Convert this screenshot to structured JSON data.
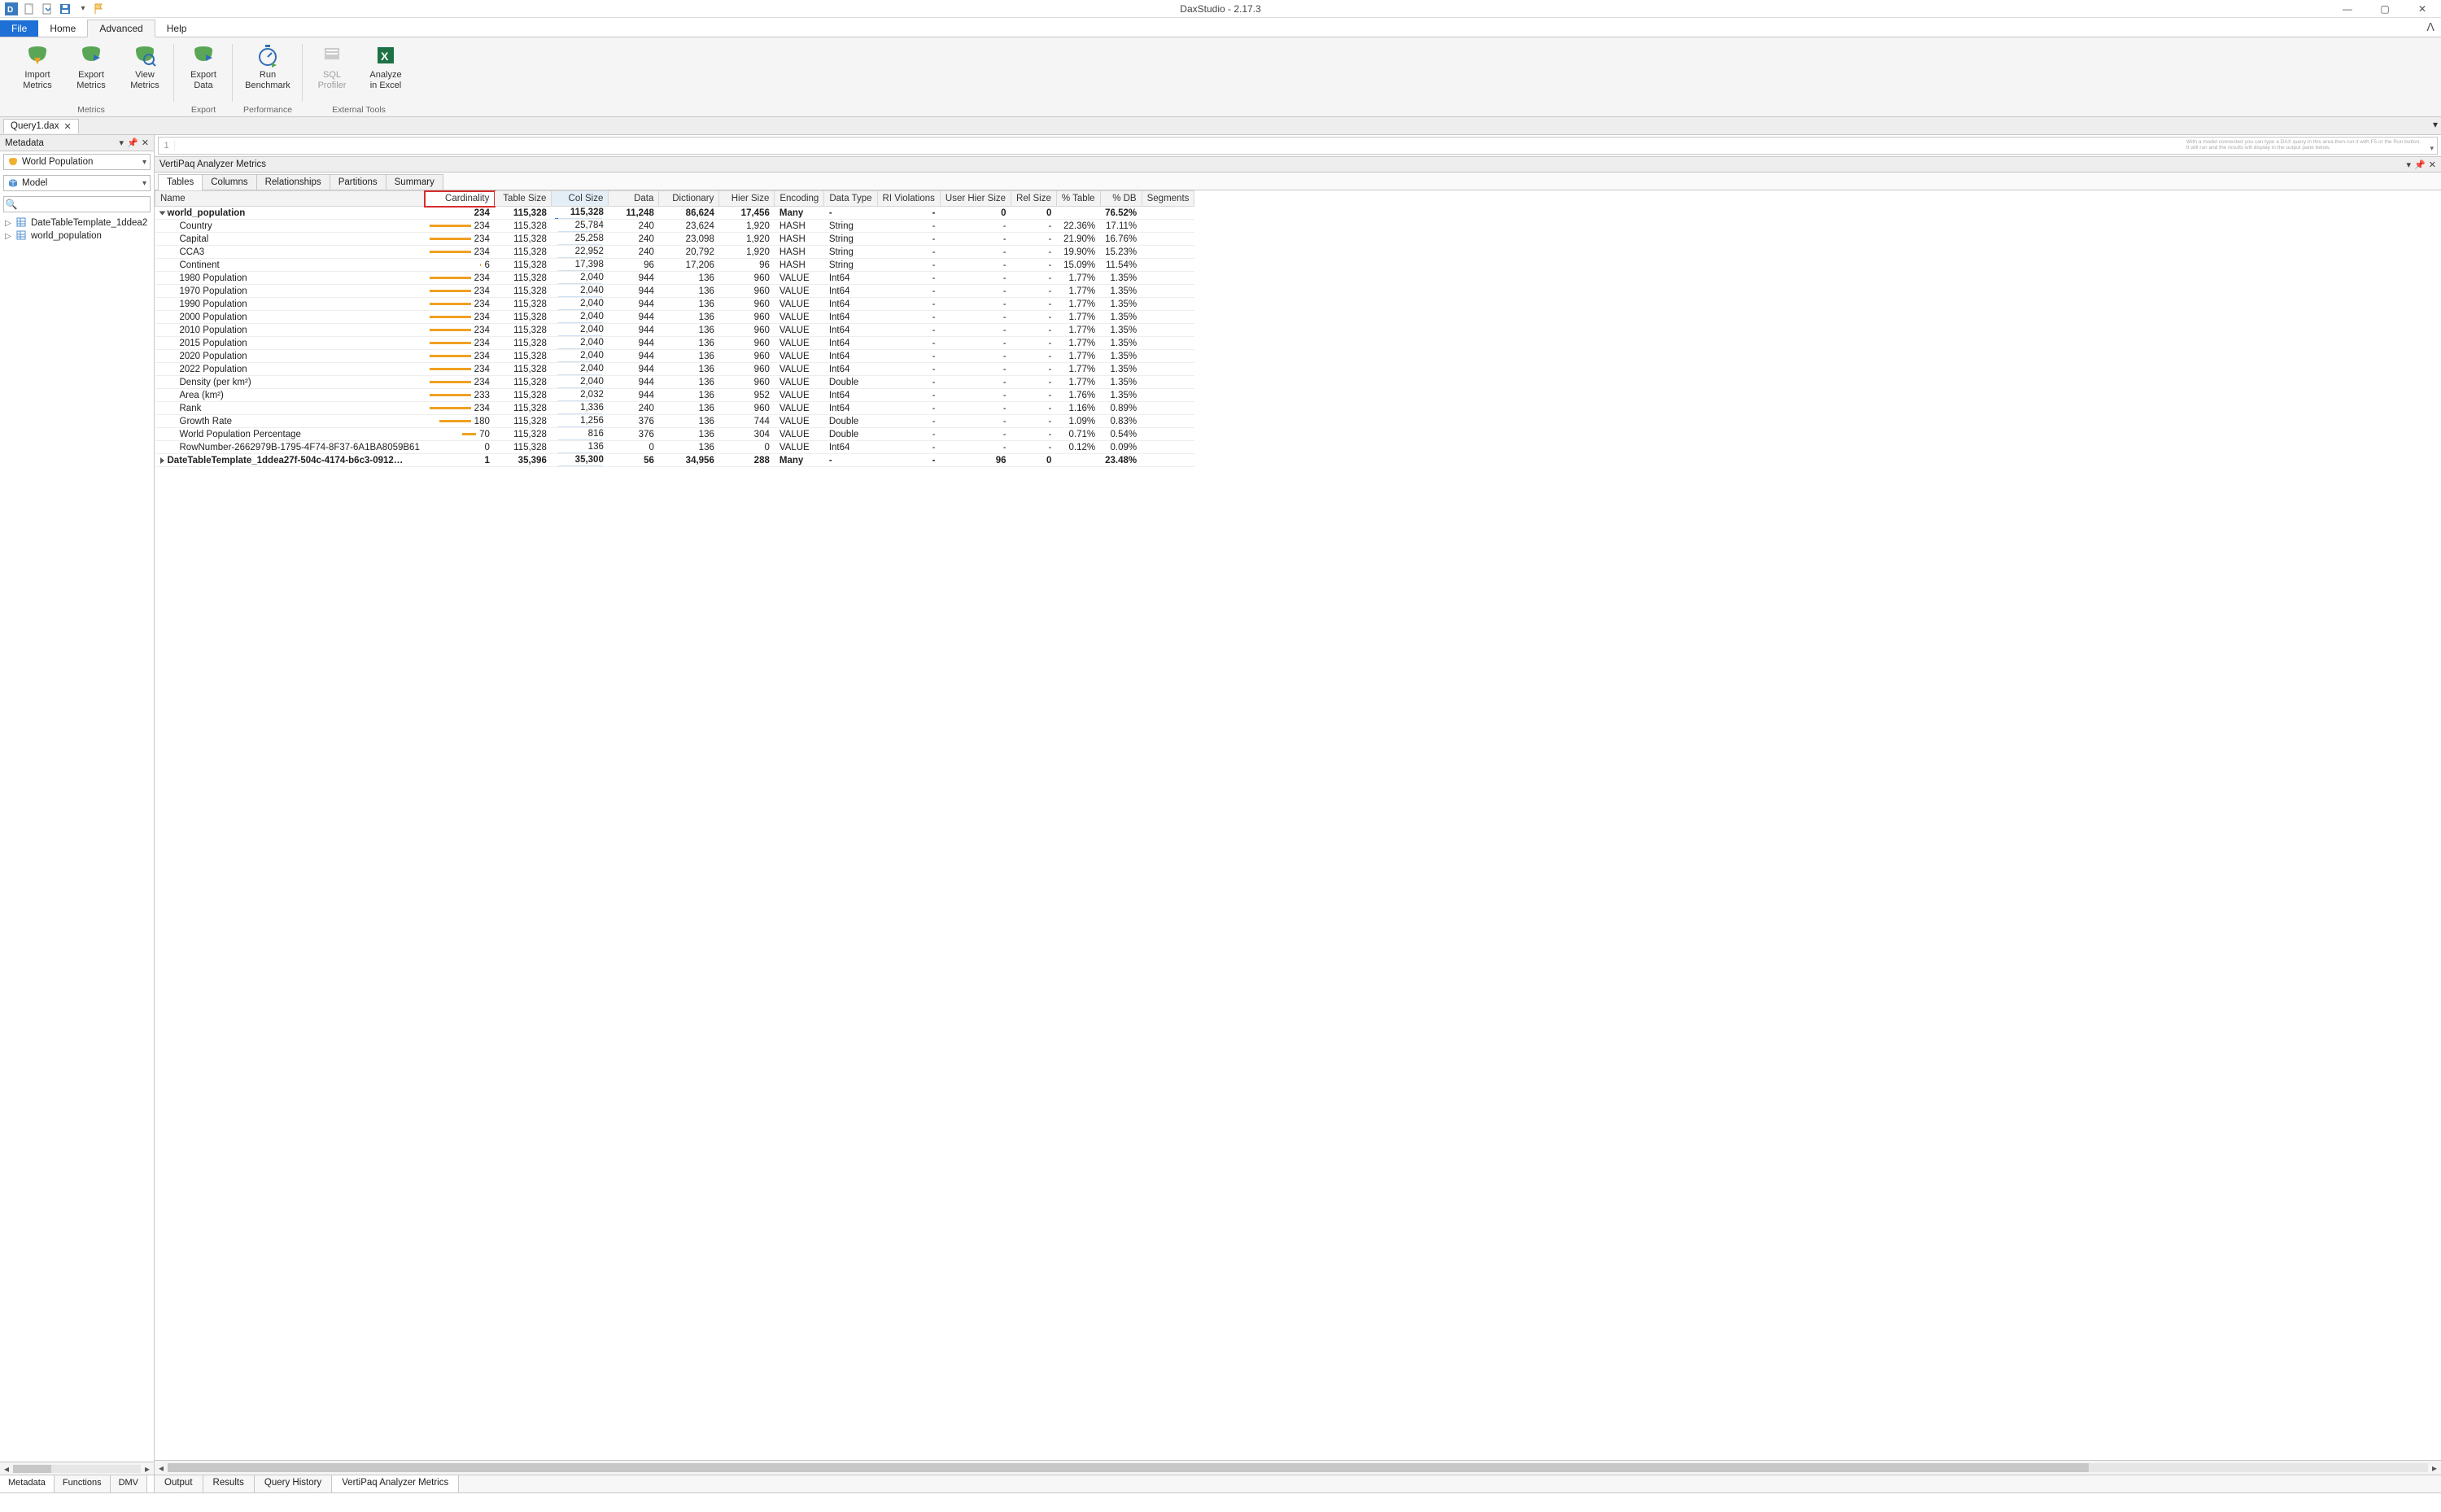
{
  "window": {
    "title": "DaxStudio - 2.17.3"
  },
  "ribbon_tabs": {
    "file": "File",
    "home": "Home",
    "advanced": "Advanced",
    "help": "Help"
  },
  "ribbon": {
    "groups": {
      "metrics": {
        "label": "Metrics",
        "import": "Import\nMetrics",
        "export": "Export\nMetrics",
        "view": "View\nMetrics"
      },
      "export": {
        "label": "Export",
        "exportdata": "Export\nData"
      },
      "perf": {
        "label": "Performance",
        "runbench": "Run\nBenchmark"
      },
      "ext": {
        "label": "External Tools",
        "sqlprof": "SQL\nProfiler",
        "excel": "Analyze\nin Excel"
      }
    }
  },
  "doc_tab": {
    "label": "Query1.dax"
  },
  "left": {
    "title": "Metadata",
    "database": "World Population",
    "model": "Model",
    "tree": {
      "n1": "DateTableTemplate_1ddea2",
      "n2": "world_population"
    },
    "bottom_tabs": {
      "metadata": "Metadata",
      "functions": "Functions",
      "dmv": "DMV"
    }
  },
  "formula": {
    "line": "1"
  },
  "right": {
    "title": "VertiPaq Analyzer Metrics",
    "subtabs": {
      "tables": "Tables",
      "columns": "Columns",
      "relationships": "Relationships",
      "partitions": "Partitions",
      "summary": "Summary"
    },
    "headers": {
      "name": "Name",
      "cardinality": "Cardinality",
      "tablesize": "Table Size",
      "colsize": "Col Size",
      "data": "Data",
      "dictionary": "Dictionary",
      "hiersize": "Hier Size",
      "encoding": "Encoding",
      "datatype": "Data Type",
      "riviol": "RI Violations",
      "userhier": "User Hier Size",
      "relsize": "Rel Size",
      "pcttable": "% Table",
      "pctdb": "% DB",
      "segments": "Segments"
    },
    "rows": [
      {
        "name": "world_population",
        "t": "group",
        "open": true,
        "card": "234",
        "tsize": "115,328",
        "csize": "115,328",
        "data": "11,248",
        "dict": "86,624",
        "hsize": "17,456",
        "enc": "Many",
        "dtype": "-",
        "ri": "-",
        "uhs": "0",
        "rel": "0",
        "pt": "",
        "pdb": "76.52%",
        "cbar": 0,
        "cul": 100
      },
      {
        "name": "Country",
        "t": "child",
        "card": "234",
        "tsize": "115,328",
        "csize": "25,784",
        "data": "240",
        "dict": "23,624",
        "hsize": "1,920",
        "enc": "HASH",
        "dtype": "String",
        "ri": "-",
        "uhs": "-",
        "rel": "-",
        "pt": "22.36%",
        "pdb": "17.11%",
        "cbar": 100,
        "cul": 22
      },
      {
        "name": "Capital",
        "t": "child",
        "card": "234",
        "tsize": "115,328",
        "csize": "25,258",
        "data": "240",
        "dict": "23,098",
        "hsize": "1,920",
        "enc": "HASH",
        "dtype": "String",
        "ri": "-",
        "uhs": "-",
        "rel": "-",
        "pt": "21.90%",
        "pdb": "16.76%",
        "cbar": 100,
        "cul": 22
      },
      {
        "name": "CCA3",
        "t": "child",
        "card": "234",
        "tsize": "115,328",
        "csize": "22,952",
        "data": "240",
        "dict": "20,792",
        "hsize": "1,920",
        "enc": "HASH",
        "dtype": "String",
        "ri": "-",
        "uhs": "-",
        "rel": "-",
        "pt": "19.90%",
        "pdb": "15.23%",
        "cbar": 100,
        "cul": 20
      },
      {
        "name": "Continent",
        "t": "child",
        "card": "6",
        "tsize": "115,328",
        "csize": "17,398",
        "data": "96",
        "dict": "17,206",
        "hsize": "96",
        "enc": "HASH",
        "dtype": "String",
        "ri": "-",
        "uhs": "-",
        "rel": "-",
        "pt": "15.09%",
        "pdb": "11.54%",
        "cbar": 3,
        "cul": 15
      },
      {
        "name": "1980 Population",
        "t": "child",
        "card": "234",
        "tsize": "115,328",
        "csize": "2,040",
        "data": "944",
        "dict": "136",
        "hsize": "960",
        "enc": "VALUE",
        "dtype": "Int64",
        "ri": "-",
        "uhs": "-",
        "rel": "-",
        "pt": "1.77%",
        "pdb": "1.35%",
        "cbar": 100,
        "cul": 2
      },
      {
        "name": "1970 Population",
        "t": "child",
        "card": "234",
        "tsize": "115,328",
        "csize": "2,040",
        "data": "944",
        "dict": "136",
        "hsize": "960",
        "enc": "VALUE",
        "dtype": "Int64",
        "ri": "-",
        "uhs": "-",
        "rel": "-",
        "pt": "1.77%",
        "pdb": "1.35%",
        "cbar": 100,
        "cul": 2
      },
      {
        "name": "1990 Population",
        "t": "child",
        "card": "234",
        "tsize": "115,328",
        "csize": "2,040",
        "data": "944",
        "dict": "136",
        "hsize": "960",
        "enc": "VALUE",
        "dtype": "Int64",
        "ri": "-",
        "uhs": "-",
        "rel": "-",
        "pt": "1.77%",
        "pdb": "1.35%",
        "cbar": 100,
        "cul": 2
      },
      {
        "name": "2000 Population",
        "t": "child",
        "card": "234",
        "tsize": "115,328",
        "csize": "2,040",
        "data": "944",
        "dict": "136",
        "hsize": "960",
        "enc": "VALUE",
        "dtype": "Int64",
        "ri": "-",
        "uhs": "-",
        "rel": "-",
        "pt": "1.77%",
        "pdb": "1.35%",
        "cbar": 100,
        "cul": 2
      },
      {
        "name": "2010 Population",
        "t": "child",
        "card": "234",
        "tsize": "115,328",
        "csize": "2,040",
        "data": "944",
        "dict": "136",
        "hsize": "960",
        "enc": "VALUE",
        "dtype": "Int64",
        "ri": "-",
        "uhs": "-",
        "rel": "-",
        "pt": "1.77%",
        "pdb": "1.35%",
        "cbar": 100,
        "cul": 2
      },
      {
        "name": "2015 Population",
        "t": "child",
        "card": "234",
        "tsize": "115,328",
        "csize": "2,040",
        "data": "944",
        "dict": "136",
        "hsize": "960",
        "enc": "VALUE",
        "dtype": "Int64",
        "ri": "-",
        "uhs": "-",
        "rel": "-",
        "pt": "1.77%",
        "pdb": "1.35%",
        "cbar": 100,
        "cul": 2
      },
      {
        "name": "2020 Population",
        "t": "child",
        "card": "234",
        "tsize": "115,328",
        "csize": "2,040",
        "data": "944",
        "dict": "136",
        "hsize": "960",
        "enc": "VALUE",
        "dtype": "Int64",
        "ri": "-",
        "uhs": "-",
        "rel": "-",
        "pt": "1.77%",
        "pdb": "1.35%",
        "cbar": 100,
        "cul": 2
      },
      {
        "name": "2022 Population",
        "t": "child",
        "card": "234",
        "tsize": "115,328",
        "csize": "2,040",
        "data": "944",
        "dict": "136",
        "hsize": "960",
        "enc": "VALUE",
        "dtype": "Int64",
        "ri": "-",
        "uhs": "-",
        "rel": "-",
        "pt": "1.77%",
        "pdb": "1.35%",
        "cbar": 100,
        "cul": 2
      },
      {
        "name": "Density (per km²)",
        "t": "child",
        "card": "234",
        "tsize": "115,328",
        "csize": "2,040",
        "data": "944",
        "dict": "136",
        "hsize": "960",
        "enc": "VALUE",
        "dtype": "Double",
        "ri": "-",
        "uhs": "-",
        "rel": "-",
        "pt": "1.77%",
        "pdb": "1.35%",
        "cbar": 100,
        "cul": 2
      },
      {
        "name": "Area (km²)",
        "t": "child",
        "card": "233",
        "tsize": "115,328",
        "csize": "2,032",
        "data": "944",
        "dict": "136",
        "hsize": "952",
        "enc": "VALUE",
        "dtype": "Int64",
        "ri": "-",
        "uhs": "-",
        "rel": "-",
        "pt": "1.76%",
        "pdb": "1.35%",
        "cbar": 99,
        "cul": 2
      },
      {
        "name": "Rank",
        "t": "child",
        "card": "234",
        "tsize": "115,328",
        "csize": "1,336",
        "data": "240",
        "dict": "136",
        "hsize": "960",
        "enc": "VALUE",
        "dtype": "Int64",
        "ri": "-",
        "uhs": "-",
        "rel": "-",
        "pt": "1.16%",
        "pdb": "0.89%",
        "cbar": 100,
        "cul": 1
      },
      {
        "name": "Growth Rate",
        "t": "child",
        "card": "180",
        "tsize": "115,328",
        "csize": "1,256",
        "data": "376",
        "dict": "136",
        "hsize": "744",
        "enc": "VALUE",
        "dtype": "Double",
        "ri": "-",
        "uhs": "-",
        "rel": "-",
        "pt": "1.09%",
        "pdb": "0.83%",
        "cbar": 77,
        "cul": 1
      },
      {
        "name": "World Population Percentage",
        "t": "child",
        "card": "70",
        "tsize": "115,328",
        "csize": "816",
        "data": "376",
        "dict": "136",
        "hsize": "304",
        "enc": "VALUE",
        "dtype": "Double",
        "ri": "-",
        "uhs": "-",
        "rel": "-",
        "pt": "0.71%",
        "pdb": "0.54%",
        "cbar": 30,
        "cul": 1
      },
      {
        "name": "RowNumber-2662979B-1795-4F74-8F37-6A1BA8059B61",
        "t": "child",
        "card": "0",
        "tsize": "115,328",
        "csize": "136",
        "data": "0",
        "dict": "136",
        "hsize": "0",
        "enc": "VALUE",
        "dtype": "Int64",
        "ri": "-",
        "uhs": "-",
        "rel": "-",
        "pt": "0.12%",
        "pdb": "0.09%",
        "cbar": 0,
        "cul": 0
      },
      {
        "name": "DateTableTemplate_1ddea27f-504c-4174-b6c3-0912…",
        "t": "group",
        "open": false,
        "card": "1",
        "tsize": "35,396",
        "csize": "35,300",
        "data": "56",
        "dict": "34,956",
        "hsize": "288",
        "enc": "Many",
        "dtype": "-",
        "ri": "-",
        "uhs": "96",
        "rel": "0",
        "pt": "",
        "pdb": "23.48%",
        "cbar": 0,
        "cul": 30
      }
    ],
    "bottom_tabs": {
      "output": "Output",
      "results": "Results",
      "history": "Query History",
      "vpa": "VertiPaq Analyzer Metrics"
    }
  }
}
